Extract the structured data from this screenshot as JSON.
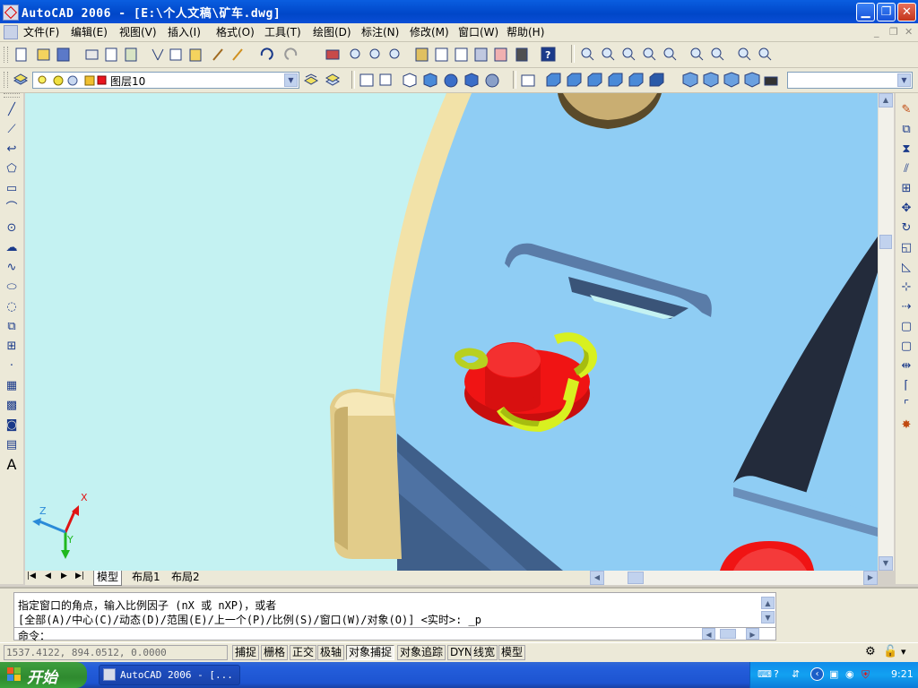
{
  "window": {
    "title": "AutoCAD 2006 - [E:\\个人文稿\\矿车.dwg]"
  },
  "menu": {
    "items": [
      {
        "label": "文件(F)"
      },
      {
        "label": "编辑(E)"
      },
      {
        "label": "视图(V)"
      },
      {
        "label": "插入(I)"
      },
      {
        "label": "格式(O)"
      },
      {
        "label": "工具(T)"
      },
      {
        "label": "绘图(D)"
      },
      {
        "label": "标注(N)"
      },
      {
        "label": "修改(M)"
      },
      {
        "label": "窗口(W)"
      },
      {
        "label": "帮助(H)"
      }
    ]
  },
  "layers": {
    "current": "图层10",
    "color": "#e8141e"
  },
  "layout_tabs": {
    "tabs": [
      {
        "label": "模型"
      },
      {
        "label": "布局1"
      },
      {
        "label": "布局2"
      }
    ],
    "active": "模型"
  },
  "ucs": {
    "x": "X",
    "y": "Y",
    "z": "Z"
  },
  "command": {
    "line1": "指定窗口的角点，输入比例因子 (nX 或 nXP)，或者",
    "line2": "[全部(A)/中心(C)/动态(D)/范围(E)/上一个(P)/比例(S)/窗口(W)/对象(O)] <实时>: _p",
    "prompt": "命令："
  },
  "status": {
    "coords": "1537.4122, 894.0512, 0.0000",
    "toggles": [
      {
        "label": "捕捉",
        "on": false
      },
      {
        "label": "栅格",
        "on": false
      },
      {
        "label": "正交",
        "on": false
      },
      {
        "label": "极轴",
        "on": false
      },
      {
        "label": "对象捕捉",
        "on": true
      },
      {
        "label": "对象追踪",
        "on": false
      },
      {
        "label": "DYN",
        "on": false
      },
      {
        "label": "线宽",
        "on": false
      },
      {
        "label": "模型",
        "on": false
      }
    ]
  },
  "taskbar": {
    "start_label": "开始",
    "task_label": "AutoCAD 2006 - [...",
    "clock": "9:21"
  },
  "colors": {
    "viewport_bg": "#c4f2f2",
    "plate": "#8fcdf4",
    "rim": "#f2e2a8",
    "red": "#f01414",
    "yellow_green": "#d8f020",
    "dark": "#232b3b"
  }
}
